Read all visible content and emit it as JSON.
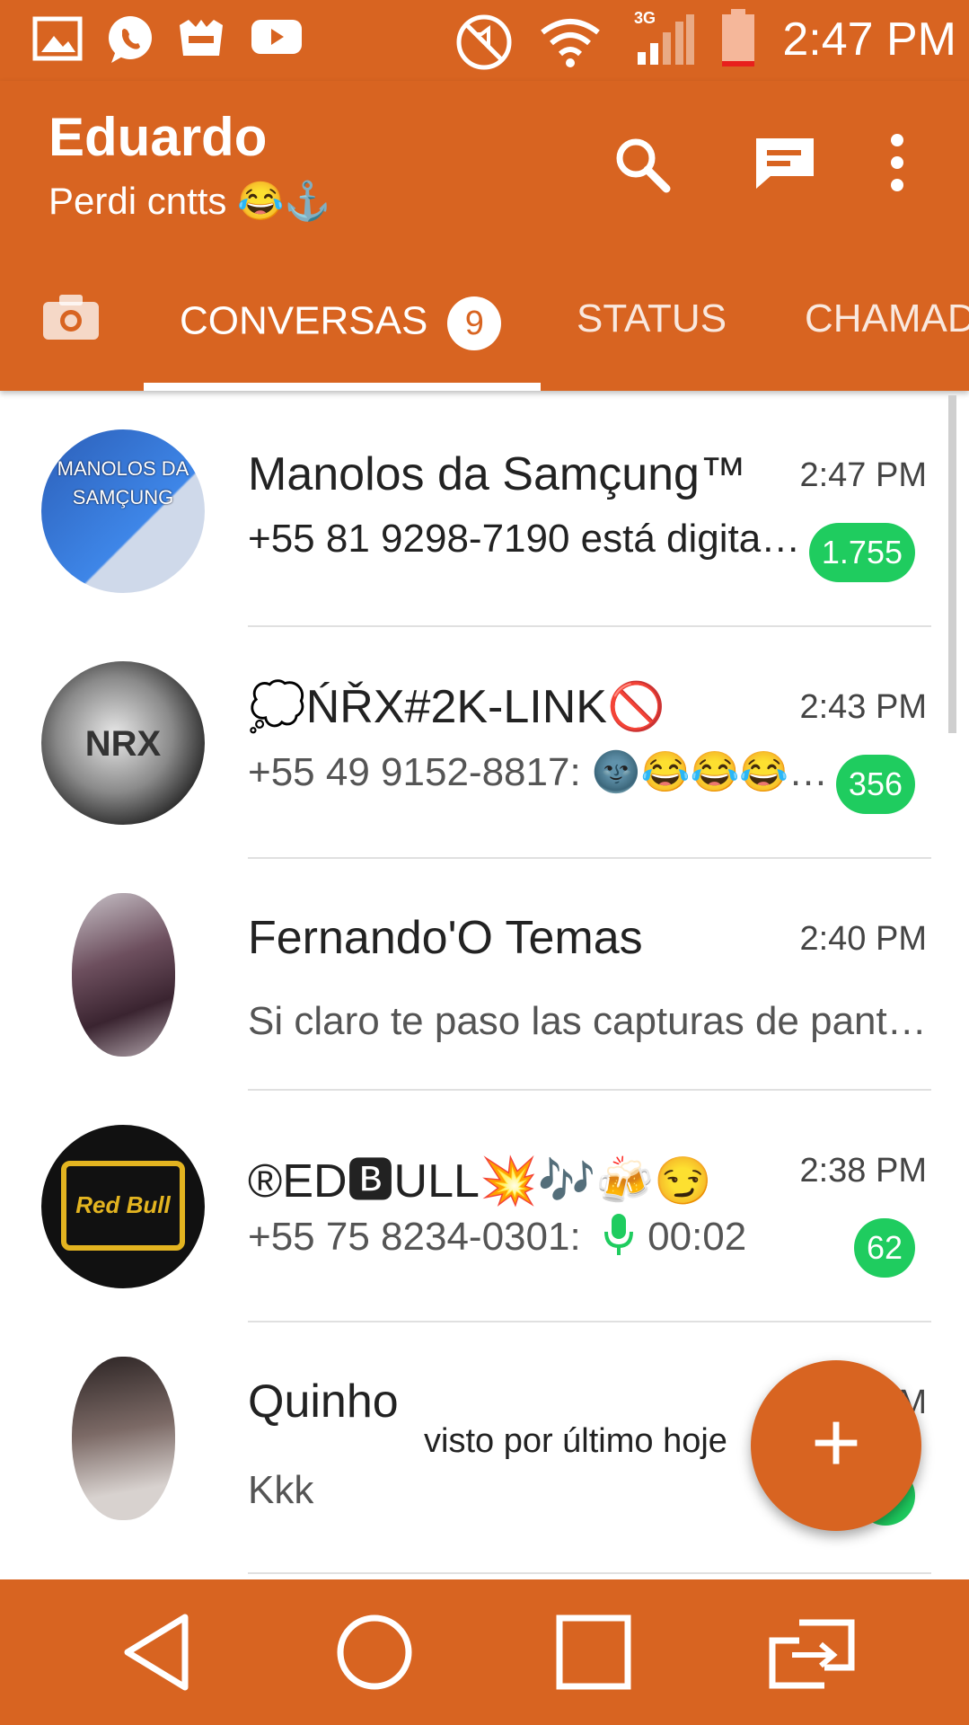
{
  "colors": {
    "accent": "#D86421",
    "unread_badge": "#1FCC5F",
    "mic": "#1FCC5F"
  },
  "statusbar": {
    "time": "2:47 PM",
    "network": "3G",
    "icons": [
      "gallery-icon",
      "whatsapp-icon",
      "game-icon",
      "youtube-icon",
      "mute-icon",
      "wifi-icon",
      "signal-icon",
      "battery-icon"
    ]
  },
  "header": {
    "title": "Eduardo",
    "subtitle": "Perdi cntts 😂⚓"
  },
  "tabs": [
    {
      "icon": "camera-icon"
    },
    {
      "label": "CONVERSAS",
      "badge": "9"
    },
    {
      "label": "STATUS"
    },
    {
      "label": "CHAMAD"
    }
  ],
  "chats": [
    {
      "name": "Manolos da Samçung™",
      "time": "2:47 PM",
      "preview": "+55 81 9298-7190 está digita…",
      "unread": "1.755",
      "avatar_text": "MANOLOS DA SAMÇUNG"
    },
    {
      "name": "💭ŃŘX#2K-LINK🚫",
      "time": "2:43 PM",
      "preview": "+55 49 9152-8817: 🌚😂😂😂…",
      "unread": "356",
      "avatar_text": "NRX"
    },
    {
      "name": "Fernando'O Temas",
      "time": "2:40 PM",
      "preview": "Si claro te paso las capturas de pant…",
      "unread": ""
    },
    {
      "name": "®ED🅱ULL💥🎶🍻😏",
      "time": "2:38 PM",
      "preview": "+55 75 8234-0301:",
      "voice_duration": "00:02",
      "unread": "62",
      "avatar_text": "Red Bull"
    },
    {
      "name": "Quinho",
      "time": "M",
      "preview": "Kkk",
      "unread": ""
    }
  ],
  "toast": "visto por último hoje",
  "fab": {
    "label": "+"
  },
  "navbar": {
    "icons": [
      "back-icon",
      "home-icon",
      "recents-icon",
      "dual-window-icon"
    ]
  }
}
